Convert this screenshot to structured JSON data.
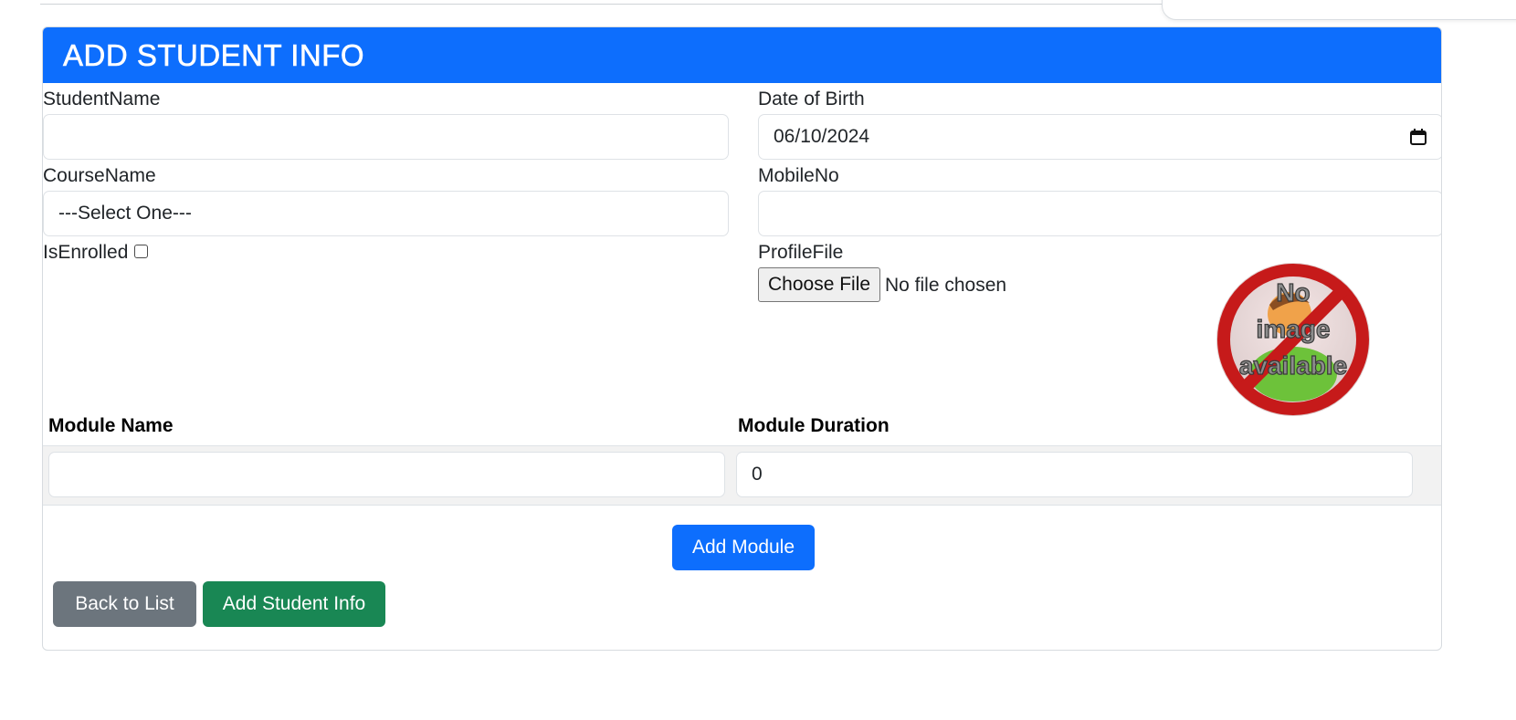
{
  "page": {
    "title": "ADD STUDENT INFO"
  },
  "form": {
    "student_name": {
      "label": "StudentName",
      "value": ""
    },
    "date_of_birth": {
      "label": "Date of Birth",
      "value": "06/10/2024"
    },
    "course_name": {
      "label": "CourseName",
      "selected": "---Select One---"
    },
    "mobile_no": {
      "label": "MobileNo",
      "value": ""
    },
    "is_enrolled": {
      "label": "IsEnrolled",
      "checked": false
    },
    "profile_file": {
      "label": "ProfileFile",
      "button": "Choose File",
      "status": "No file chosen"
    },
    "profile_image": {
      "lines": [
        "No",
        "image",
        "available"
      ]
    }
  },
  "modules": {
    "headers": [
      "Module Name",
      "Module Duration"
    ],
    "rows": [
      {
        "name": "",
        "duration": "0"
      }
    ],
    "add_button": "Add Module"
  },
  "actions": {
    "back": "Back to List",
    "submit": "Add Student Info"
  },
  "colors": {
    "primary": "#0d6efd",
    "secondary": "#6c757d",
    "success": "#198754"
  },
  "icons": {
    "date": "calendar-icon",
    "no_image": "no-image-placeholder"
  }
}
